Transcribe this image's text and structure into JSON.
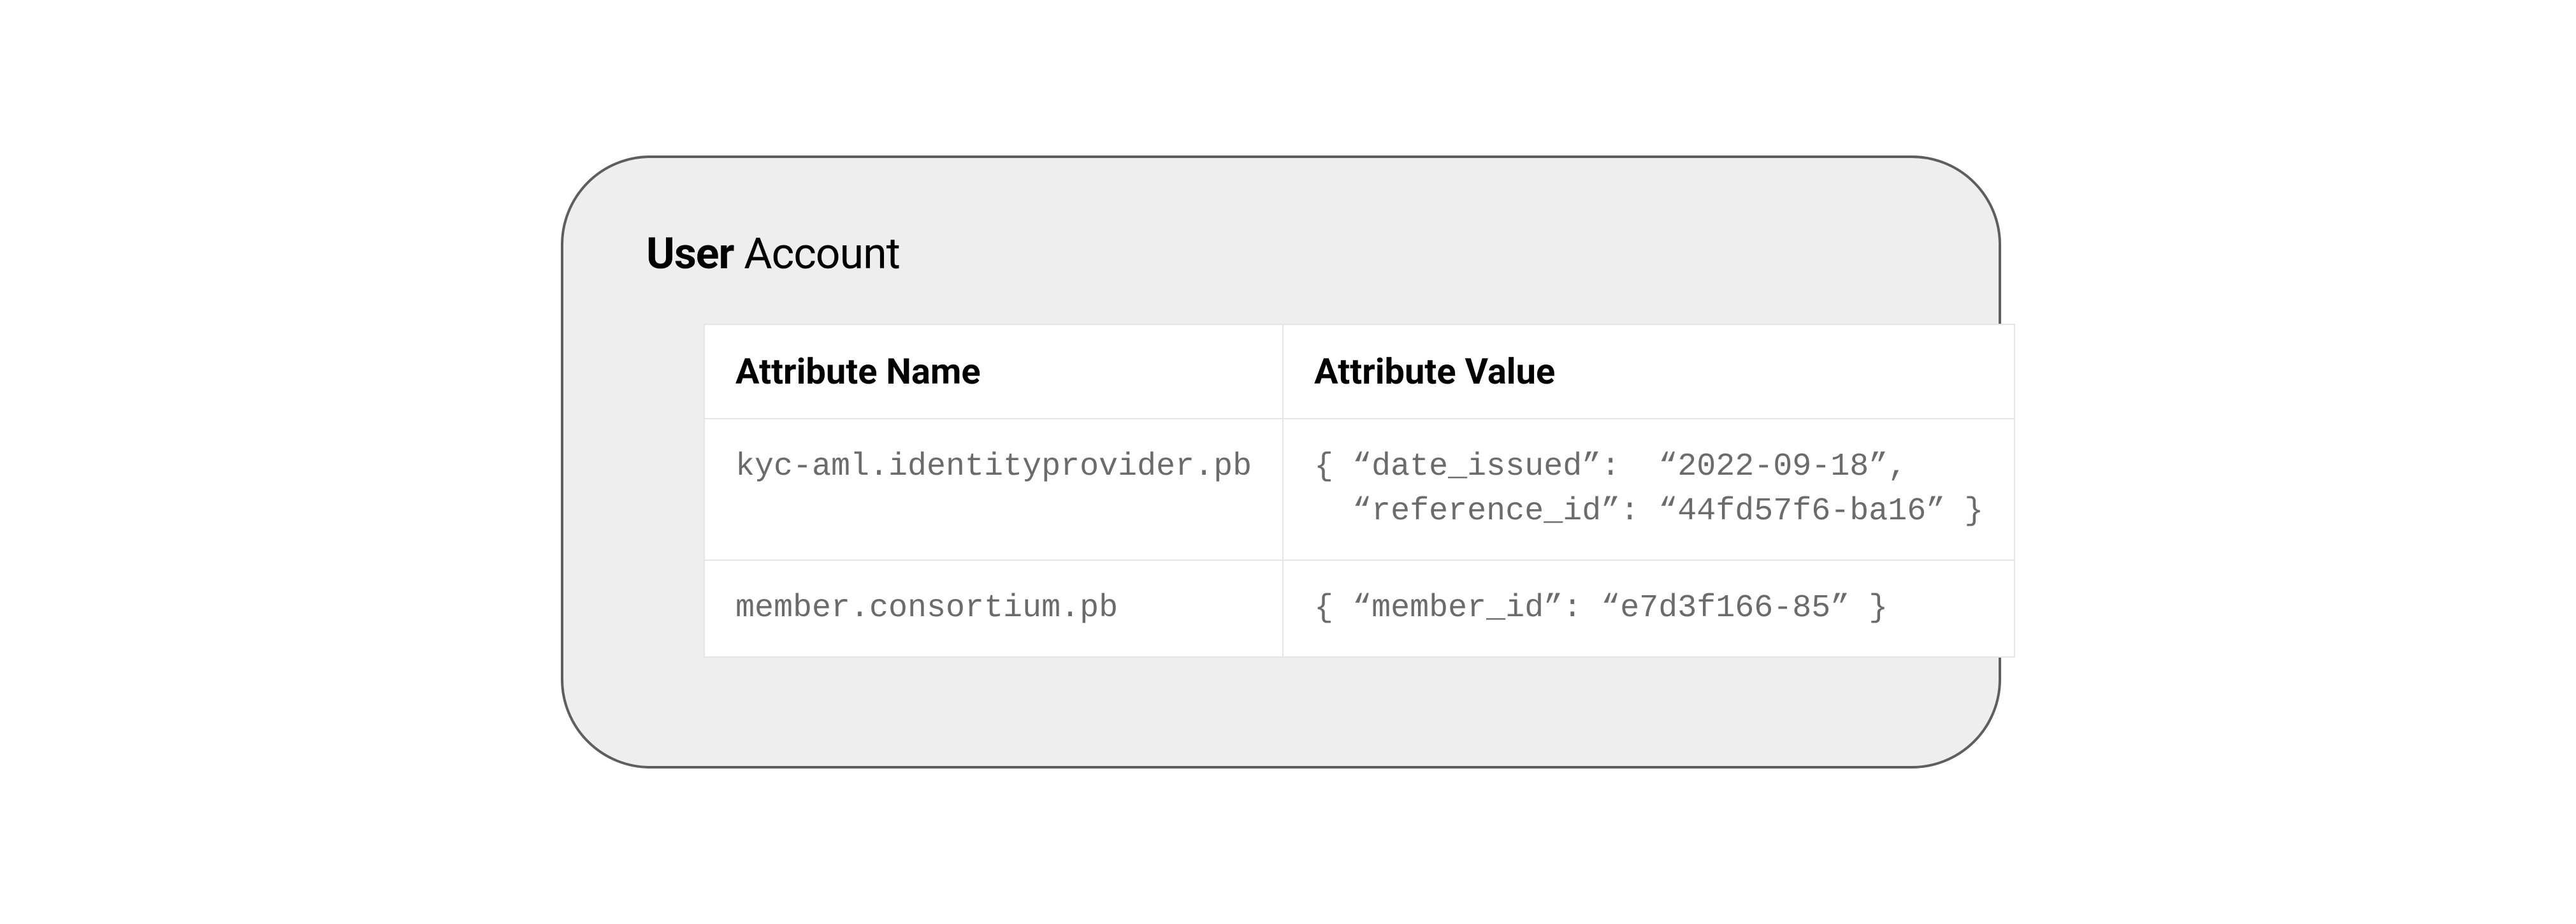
{
  "card": {
    "title_bold": "User",
    "title_regular": " Account"
  },
  "table": {
    "headers": {
      "name": "Attribute Name",
      "value": "Attribute Value"
    },
    "rows": [
      {
        "name": "kyc-aml.identityprovider.pb",
        "value": "{ “date_issued”:  “2022-09-18”,\n  “reference_id”: “44fd57f6-ba16” }"
      },
      {
        "name": "member.consortium.pb",
        "value": "{ “member_id”: “e7d3f166-85” }"
      }
    ]
  }
}
